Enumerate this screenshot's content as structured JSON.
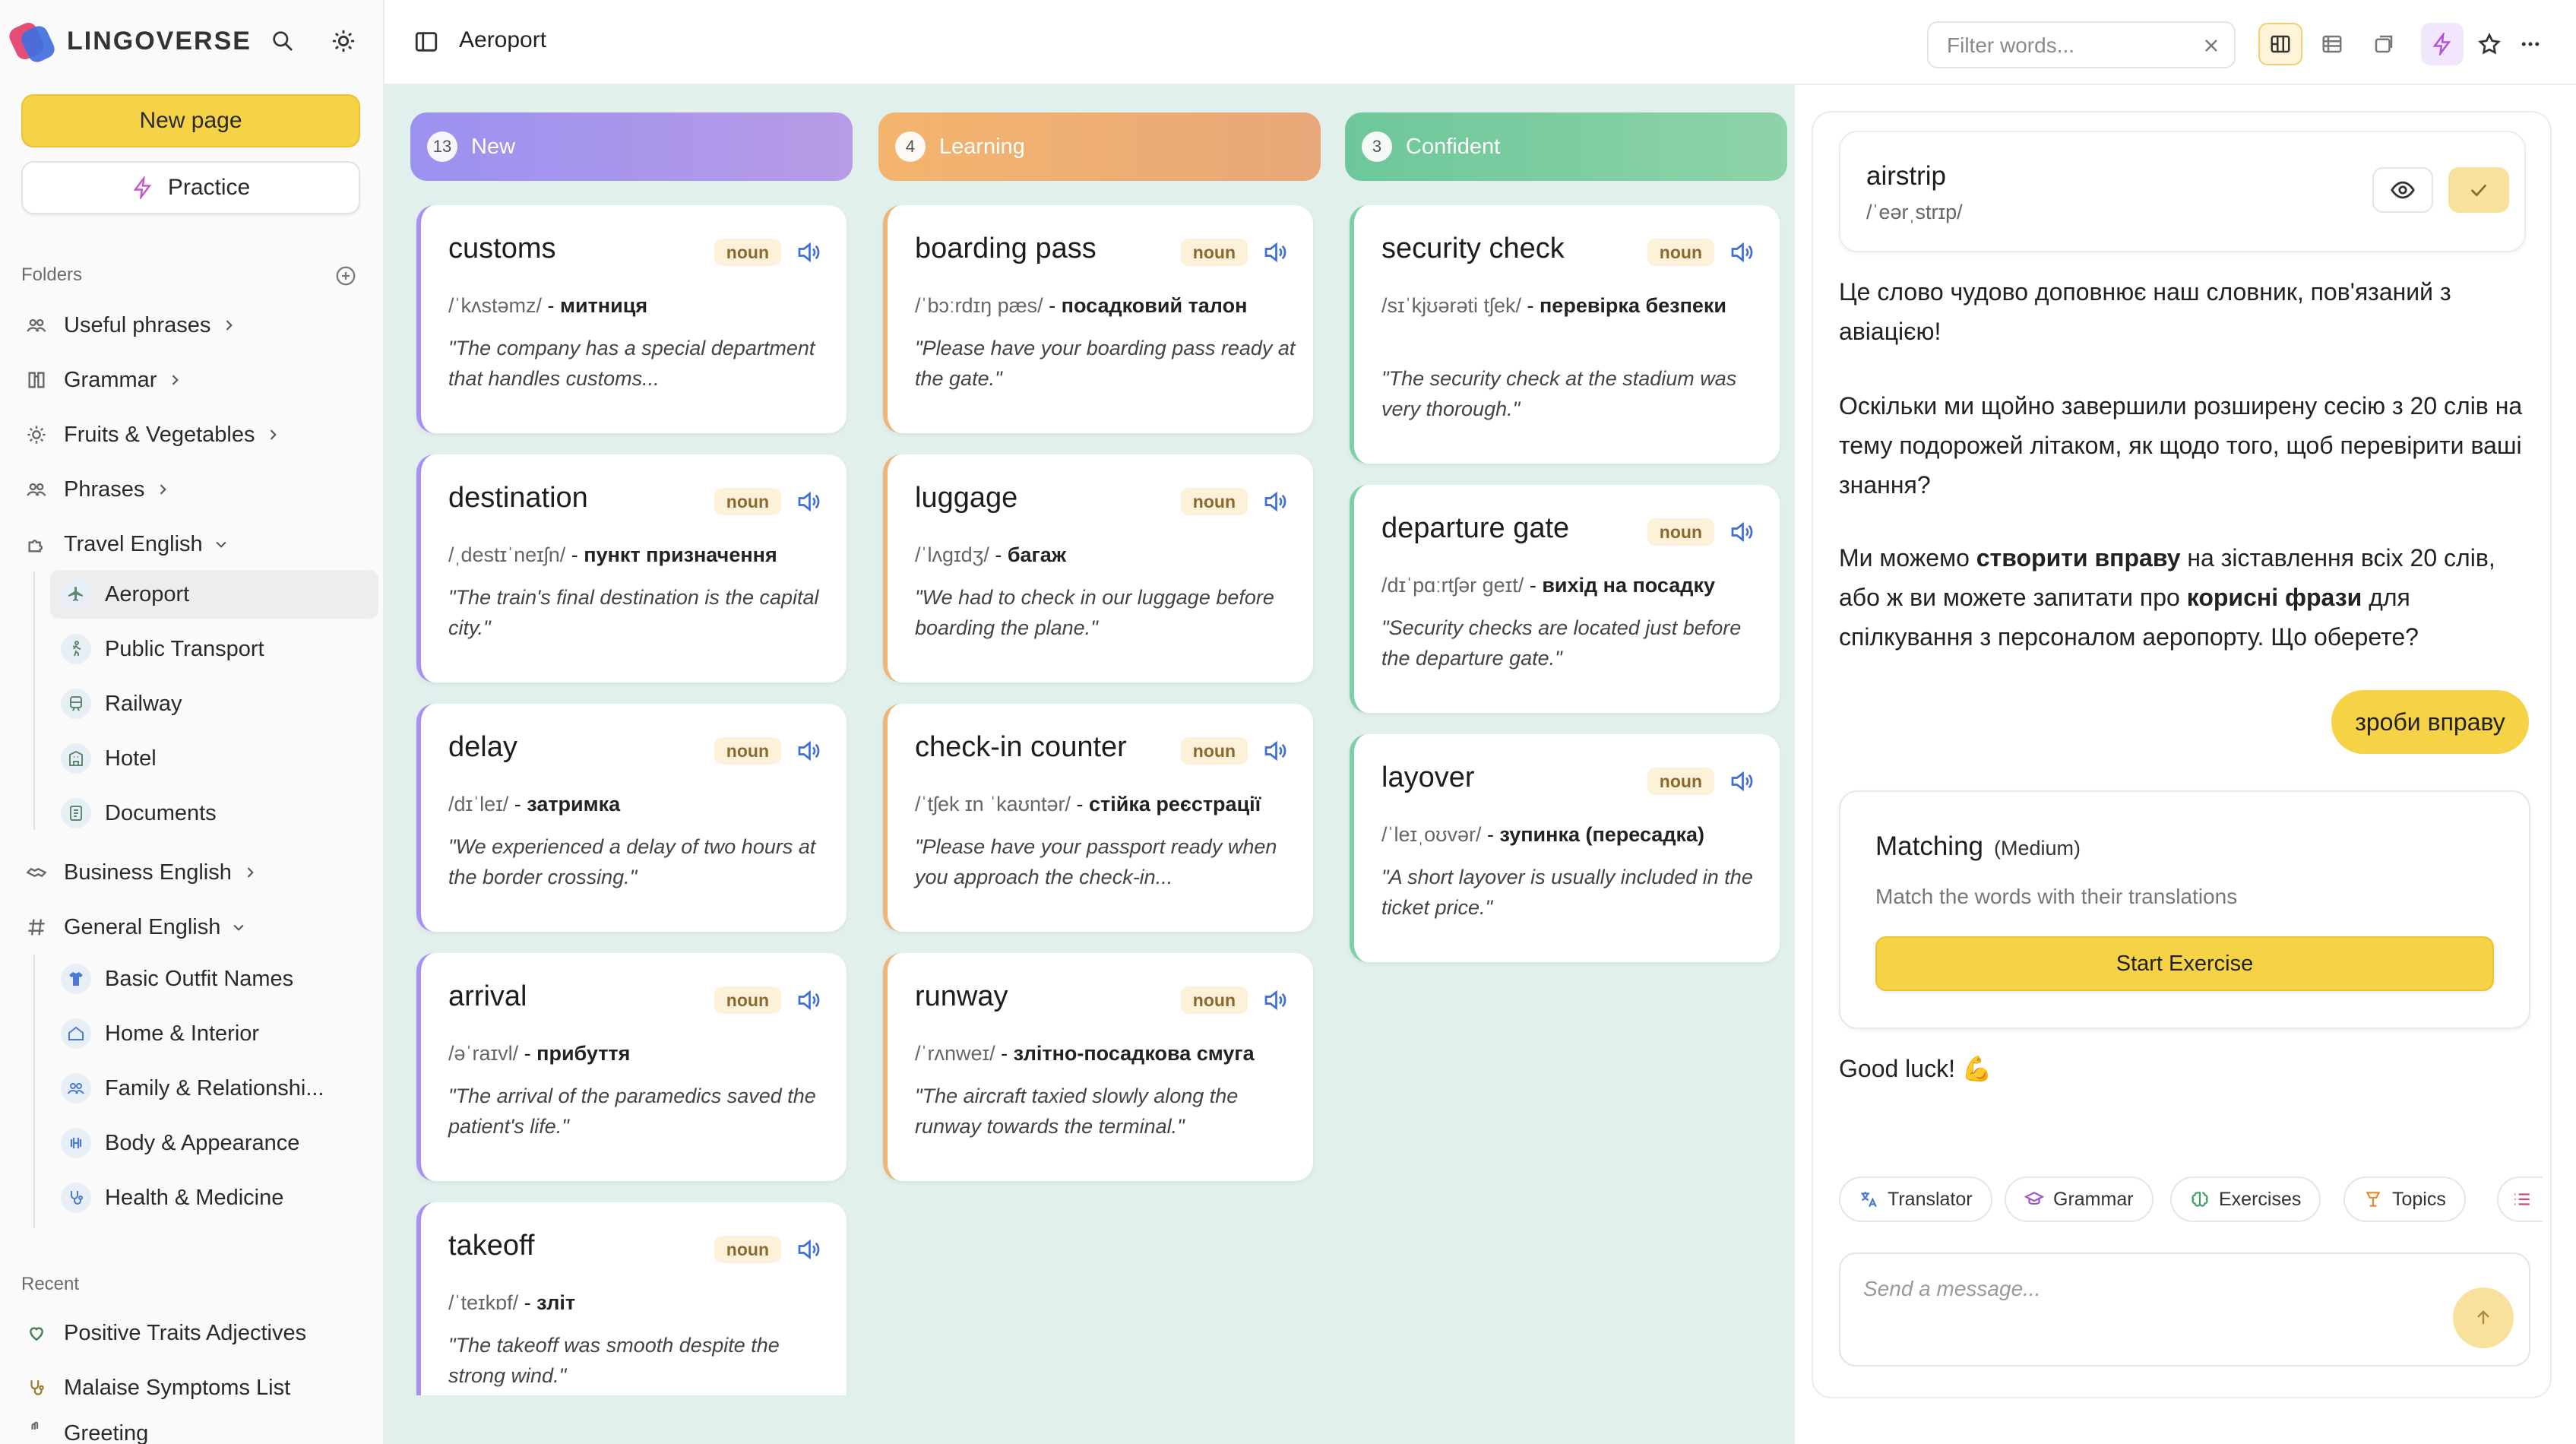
{
  "app": {
    "name": "LINGOVERSE"
  },
  "sidebar": {
    "new_page_label": "New page",
    "practice_label": "Practice",
    "folders_label": "Folders",
    "items": [
      {
        "label": "Useful phrases",
        "icon": "people-icon"
      },
      {
        "label": "Grammar",
        "icon": "book-icon"
      },
      {
        "label": "Fruits & Vegetables",
        "icon": "sun-icon"
      },
      {
        "label": "Phrases",
        "icon": "people-icon"
      },
      {
        "label": "Travel English",
        "icon": "puzzle-icon"
      }
    ],
    "travel_children": [
      {
        "label": "Aeroport",
        "icon": "plane-icon"
      },
      {
        "label": "Public Transport",
        "icon": "walk-icon"
      },
      {
        "label": "Railway",
        "icon": "train-icon"
      },
      {
        "label": "Hotel",
        "icon": "building-icon"
      },
      {
        "label": "Documents",
        "icon": "document-icon"
      }
    ],
    "more_items": [
      {
        "label": "Business English",
        "icon": "handshake-icon"
      },
      {
        "label": "General English",
        "icon": "hash-icon"
      }
    ],
    "general_children": [
      {
        "label": "Basic Outfit Names",
        "icon": "shirt-icon"
      },
      {
        "label": "Home & Interior",
        "icon": "home-icon"
      },
      {
        "label": "Family & Relationshi...",
        "icon": "people-icon"
      },
      {
        "label": "Body & Appearance",
        "icon": "dumbbell-icon"
      },
      {
        "label": "Health & Medicine",
        "icon": "stethoscope-icon"
      }
    ],
    "recent_label": "Recent",
    "recent": [
      {
        "label": "Positive Traits Adjectives",
        "icon": "heart-icon"
      },
      {
        "label": "Malaise Symptoms List",
        "icon": "stethoscope-icon"
      },
      {
        "label": "Greeting",
        "icon": "wave-icon"
      }
    ]
  },
  "header": {
    "page_title": "Aeroport",
    "filter_placeholder": "Filter words..."
  },
  "columns": [
    {
      "title": "New",
      "count": "13"
    },
    {
      "title": "Learning",
      "count": "4"
    },
    {
      "title": "Confident",
      "count": "3"
    }
  ],
  "cards": {
    "new": [
      {
        "word": "customs",
        "pos": "noun",
        "ipa": "/ˈkʌstəmz/",
        "translation": "митниця",
        "example": "\"The company has a special department that handles customs..."
      },
      {
        "word": "destination",
        "pos": "noun",
        "ipa": "/ˌdestɪˈneɪʃn/",
        "translation": "пункт призначення",
        "example": "\"The train's final destination is the capital city.\""
      },
      {
        "word": "delay",
        "pos": "noun",
        "ipa": "/dɪˈleɪ/",
        "translation": "затримка",
        "example": "\"We experienced a delay of two hours at the border crossing.\""
      },
      {
        "word": "arrival",
        "pos": "noun",
        "ipa": "/əˈraɪvl/",
        "translation": "прибуття",
        "example": "\"The arrival of the paramedics saved the patient's life.\""
      },
      {
        "word": "takeoff",
        "pos": "noun",
        "ipa": "/ˈteɪkɒf/",
        "translation": "зліт",
        "example": "\"The takeoff was smooth despite the strong wind.\""
      }
    ],
    "learning": [
      {
        "word": "boarding pass",
        "pos": "noun",
        "ipa": "/ˈbɔːrdɪŋ pæs/",
        "translation": "посадковий талон",
        "example": "\"Please have your boarding pass ready at the gate.\""
      },
      {
        "word": "luggage",
        "pos": "noun",
        "ipa": "/ˈlʌɡɪdʒ/",
        "translation": "багаж",
        "example": "\"We had to check in our luggage before boarding the plane.\""
      },
      {
        "word": "check-in counter",
        "pos": "noun",
        "ipa": "/ˈtʃek ɪn ˈkaʊntər/",
        "translation": "стійка реєстрації",
        "example": "\"Please have your passport ready when you approach the check-in..."
      },
      {
        "word": "runway",
        "pos": "noun",
        "ipa": "/ˈrʌnweɪ/",
        "translation": "злітно-посадкова смуга",
        "example": "\"The aircraft taxied slowly along the runway towards the terminal.\""
      }
    ],
    "confident": [
      {
        "word": "security check",
        "pos": "noun",
        "ipa": "/sɪˈkjʊərəti tʃek/",
        "translation": "перевірка безпеки",
        "example": "\"The security check at the stadium was very thorough.\""
      },
      {
        "word": "departure gate",
        "pos": "noun",
        "ipa": "/dɪˈpɑːrtʃər ɡeɪt/",
        "translation": "вихід на посадку",
        "example": "\"Security checks are located just before the departure gate.\""
      },
      {
        "word": "layover",
        "pos": "noun",
        "ipa": "/ˈleɪˌoʊvər/",
        "translation": "зупинка (пересадка)",
        "example": "\"A short layover is usually included in the ticket price.\""
      }
    ]
  },
  "panel": {
    "word": "airstrip",
    "ipa": "/ˈeərˌstrɪp/",
    "msg1": "Це слово чудово доповнює наш словник, пов'язаний з авіацією!",
    "msg2": "Оскільки ми щойно завершили розширену сесію з 20 слів на тему подорожей літаком, як щодо того, щоб перевірити ваші знання?",
    "msg3_a": "Ми можемо ",
    "msg3_b": "створити вправу",
    "msg3_c": " на зіставлення всіх 20 слів, або ж ви можете запитати про ",
    "msg3_d": "корисні фрази",
    "msg3_e": " для спілкування з персоналом аеропорту. Що оберете?",
    "user_msg": "зроби вправу",
    "exercise_title": "Matching",
    "exercise_level": "(Medium)",
    "exercise_desc": "Match the words with their translations",
    "start_label": "Start Exercise",
    "goodluck": "Good luck! 💪",
    "chips": [
      "Translator",
      "Grammar",
      "Exercises",
      "Topics"
    ],
    "composer_placeholder": "Send a message..."
  },
  "colors": {
    "accent": "#f6d247",
    "new": "#a792f0",
    "learning": "#efb47a",
    "confident": "#7fcfa5",
    "board_bg": "#e1f0ec"
  }
}
